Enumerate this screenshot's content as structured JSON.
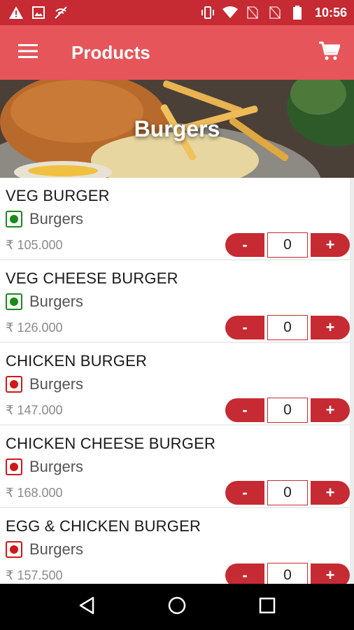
{
  "status_bar": {
    "time": "10:56",
    "icons": [
      "warning-icon",
      "image-icon",
      "no-wifi-call-icon",
      "vibrate-icon",
      "wifi-icon",
      "no-sim-icon",
      "no-sim-icon",
      "battery-icon"
    ],
    "color": "#c62a32"
  },
  "app_bar": {
    "title": "Products",
    "menu_icon": "hamburger-menu-icon",
    "cart_icon": "shopping-cart-icon",
    "color": "#e5555a"
  },
  "banner": {
    "title": "Burgers"
  },
  "products": [
    {
      "name": "VEG BURGER",
      "category": "Burgers",
      "type": "veg",
      "price": "₹ 105.000",
      "qty": "0"
    },
    {
      "name": "VEG CHEESE BURGER",
      "category": "Burgers",
      "type": "veg",
      "price": "₹ 126.000",
      "qty": "0"
    },
    {
      "name": "CHICKEN BURGER",
      "category": "Burgers",
      "type": "non-veg",
      "price": "₹ 147.000",
      "qty": "0"
    },
    {
      "name": "CHICKEN CHEESE BURGER",
      "category": "Burgers",
      "type": "non-veg",
      "price": "₹ 168.000",
      "qty": "0"
    },
    {
      "name": "EGG & CHICKEN BURGER",
      "category": "Burgers",
      "type": "non-veg",
      "price": "₹ 157.500",
      "qty": "0"
    }
  ],
  "qty_controls": {
    "minus_label": "-",
    "plus_label": "+"
  },
  "colors": {
    "accent": "#c62a32",
    "veg": "#1a8a1a",
    "non_veg": "#d01818"
  },
  "nav_bar": {
    "icons": [
      "back-icon",
      "home-icon",
      "recents-icon"
    ]
  }
}
